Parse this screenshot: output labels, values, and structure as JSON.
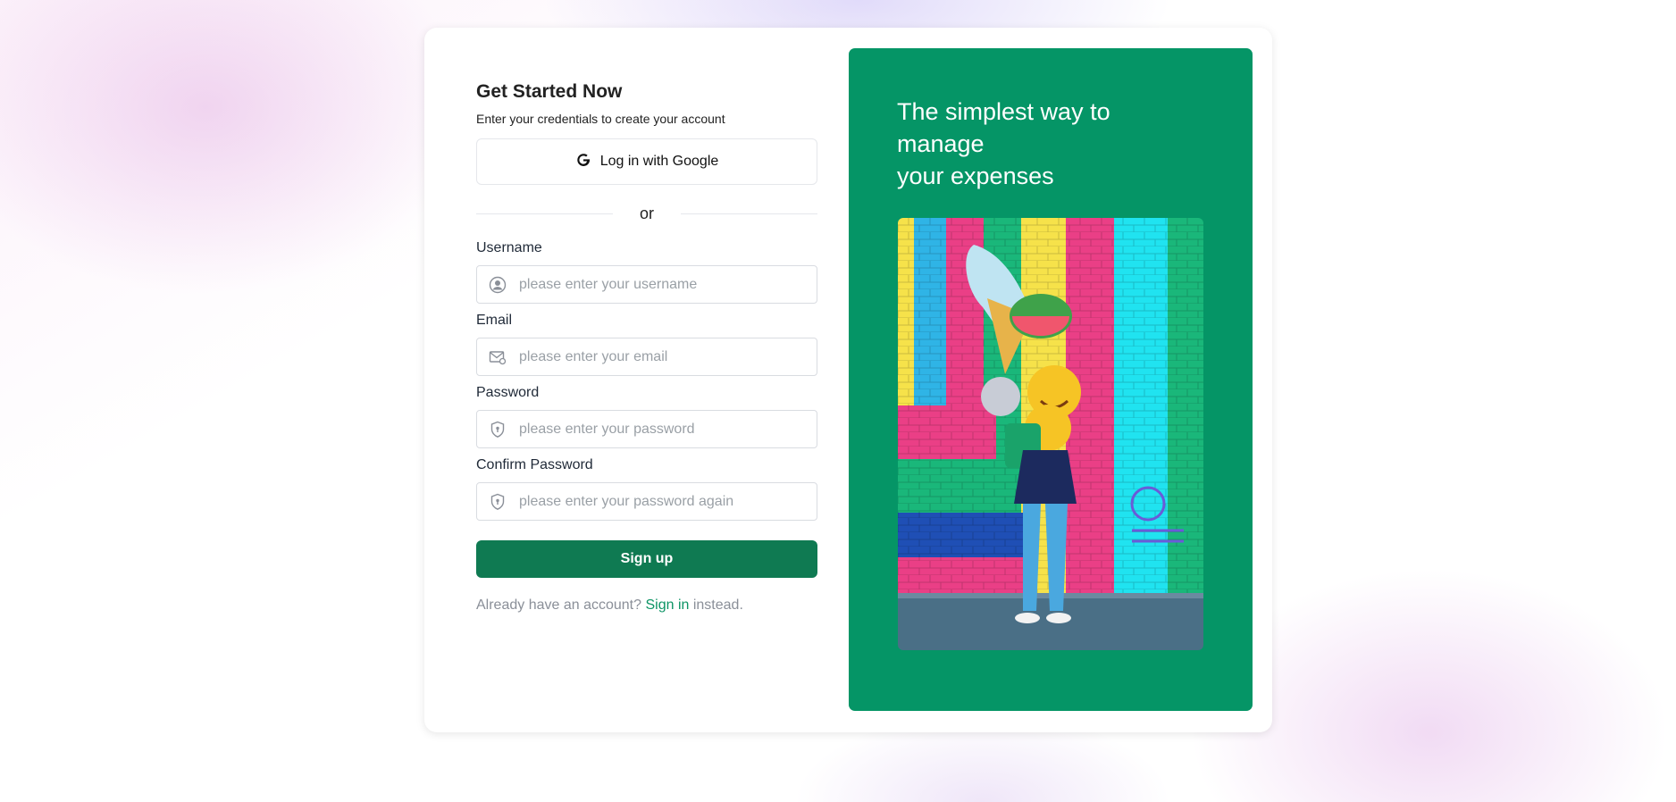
{
  "form": {
    "title": "Get Started Now",
    "subtitle": "Enter your credentials to create your account",
    "google_button_label": "Log in with Google",
    "divider_text": "or",
    "fields": {
      "username": {
        "label": "Username",
        "placeholder": "please enter your username",
        "icon": "user-icon"
      },
      "email": {
        "label": "Email",
        "placeholder": "please enter your email",
        "icon": "mail-icon"
      },
      "password": {
        "label": "Password",
        "placeholder": "please enter your password",
        "icon": "shield-icon"
      },
      "confirm_password": {
        "label": "Confirm Password",
        "placeholder": "please enter your password again",
        "icon": "shield-icon"
      }
    },
    "submit_label": "Sign up",
    "footer": {
      "prefix": "Already have an account?",
      "link": "Sign in",
      "suffix": "instead."
    }
  },
  "promo": {
    "title_line1": "The simplest way to manage",
    "title_line2": "your expenses",
    "image": "person-with-balloons-photo"
  },
  "colors": {
    "accent": "#059566",
    "button": "#0f7a52",
    "link": "#0d9465"
  }
}
